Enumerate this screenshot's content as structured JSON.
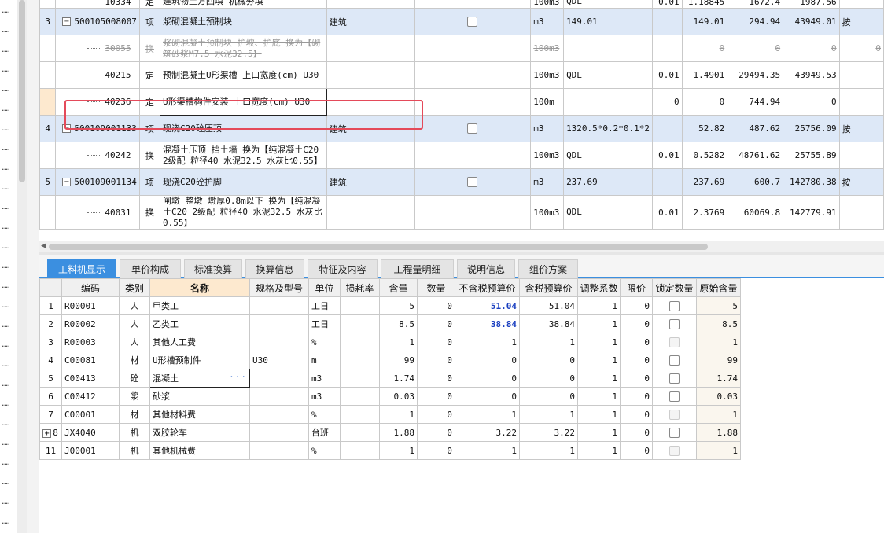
{
  "top_rows": [
    {
      "kind": "child",
      "seq": "",
      "code": "10334",
      "cat": "定",
      "name": "建筑物土方回填 机械夯填",
      "major": "",
      "unit": "100m3",
      "qty_expr": "QDL",
      "content": "0.01",
      "qty": "1.18845",
      "price": "1672.4",
      "total": "1987.56",
      "extra": ""
    },
    {
      "kind": "main",
      "seq": "3",
      "code": "500105008007",
      "cat": "项",
      "name": "浆砌混凝土预制块",
      "major": "建筑",
      "unit": "m3",
      "qty_expr": "149.01",
      "content": "",
      "qty": "149.01",
      "price": "294.94",
      "total": "43949.01",
      "extra": "按"
    },
    {
      "kind": "strike",
      "seq": "",
      "code": "30055",
      "cat": "换",
      "name": "浆砌混凝土预制块 护坡、护底  换为【砌筑砂浆M7.5 水泥32.5】",
      "major": "",
      "unit": "100m3",
      "qty_expr": "",
      "content": "",
      "qty": "0",
      "price": "0",
      "total": "0",
      "extra": "0"
    },
    {
      "kind": "child",
      "seq": "",
      "code": "40215",
      "cat": "定",
      "name": "预制混凝土U形渠槽 上口宽度(cm) U30",
      "major": "",
      "unit": "100m3",
      "qty_expr": "QDL",
      "content": "0.01",
      "qty": "1.4901",
      "price": "29494.35",
      "total": "43949.53",
      "extra": ""
    },
    {
      "kind": "edit",
      "seq": "",
      "code": "40236",
      "cat": "定",
      "name": "U形渠槽构件安装 上口宽度(cm) U30",
      "major": "",
      "unit": "100m",
      "qty_expr": "",
      "content": "0",
      "qty": "0",
      "price": "744.94",
      "total": "0",
      "extra": ""
    },
    {
      "kind": "main",
      "seq": "4",
      "code": "500109001133",
      "cat": "项",
      "name": "现浇C20砼压顶",
      "major": "建筑",
      "unit": "m3",
      "qty_expr": "1320.5*0.2*0.1*2",
      "content": "",
      "qty": "52.82",
      "price": "487.62",
      "total": "25756.09",
      "extra": "按"
    },
    {
      "kind": "child",
      "seq": "",
      "code": "40242",
      "cat": "换",
      "name": "混凝土压顶 挡土墙  换为【纯混凝土C20 2级配 粒径40 水泥32.5 水灰比0.55】",
      "major": "",
      "unit": "100m3",
      "qty_expr": "QDL",
      "content": "0.01",
      "qty": "0.5282",
      "price": "48761.62",
      "total": "25755.89",
      "extra": ""
    },
    {
      "kind": "main",
      "seq": "5",
      "code": "500109001134",
      "cat": "项",
      "name": "现浇C20砼护脚",
      "major": "建筑",
      "unit": "m3",
      "qty_expr": "237.69",
      "content": "",
      "qty": "237.69",
      "price": "600.7",
      "total": "142780.38",
      "extra": "按"
    },
    {
      "kind": "child",
      "seq": "",
      "code": "40031",
      "cat": "换",
      "name": "闸墩 整墩 墩厚0.8m以下  换为【纯混凝土C20 2级配 粒径40 水泥32.5 水灰比0.55】",
      "major": "",
      "unit": "100m3",
      "qty_expr": "QDL",
      "content": "0.01",
      "qty": "2.3769",
      "price": "60069.8",
      "total": "142779.91",
      "extra": ""
    }
  ],
  "tabs": [
    "工料机显示",
    "单价构成",
    "标准换算",
    "换算信息",
    "特征及内容",
    "工程量明细",
    "说明信息",
    "组价方案"
  ],
  "columns": [
    "",
    "编码",
    "类别",
    "名称",
    "规格及型号",
    "单位",
    "损耗率",
    "含量",
    "数量",
    "不含税预算价",
    "含税预算价",
    "调整系数",
    "限价",
    "锁定数量",
    "原始含量"
  ],
  "rows": [
    {
      "n": "1",
      "code": "R00001",
      "cat": "人",
      "name": "甲类工",
      "spec": "",
      "unit": "工日",
      "loss": "",
      "amt": "5",
      "qty": "0",
      "p1": "51.04",
      "p2": "51.04",
      "adj": "1",
      "limit": "0",
      "orig": "5",
      "blue": true,
      "dis": false
    },
    {
      "n": "2",
      "code": "R00002",
      "cat": "人",
      "name": "乙类工",
      "spec": "",
      "unit": "工日",
      "loss": "",
      "amt": "8.5",
      "qty": "0",
      "p1": "38.84",
      "p2": "38.84",
      "adj": "1",
      "limit": "0",
      "orig": "8.5",
      "blue": true,
      "dis": false
    },
    {
      "n": "3",
      "code": "R00003",
      "cat": "人",
      "name": "其他人工费",
      "spec": "",
      "unit": "%",
      "loss": "",
      "amt": "1",
      "qty": "0",
      "p1": "1",
      "p2": "1",
      "adj": "1",
      "limit": "0",
      "orig": "1",
      "blue": false,
      "dis": true
    },
    {
      "n": "4",
      "code": "C00081",
      "cat": "材",
      "name": "U形槽预制件",
      "spec": "U30",
      "unit": "m",
      "loss": "",
      "amt": "99",
      "qty": "0",
      "p1": "0",
      "p2": "0",
      "adj": "1",
      "limit": "0",
      "orig": "99",
      "blue": false,
      "dis": false
    },
    {
      "n": "5",
      "code": "C00413",
      "cat": "砼",
      "name": "混凝土",
      "spec": "",
      "unit": "m3",
      "loss": "",
      "amt": "1.74",
      "qty": "0",
      "p1": "0",
      "p2": "0",
      "adj": "1",
      "limit": "0",
      "orig": "1.74",
      "blue": false,
      "dis": false,
      "sel": true
    },
    {
      "n": "6",
      "code": "C00412",
      "cat": "浆",
      "name": "砂浆",
      "spec": "",
      "unit": "m3",
      "loss": "",
      "amt": "0.03",
      "qty": "0",
      "p1": "0",
      "p2": "0",
      "adj": "1",
      "limit": "0",
      "orig": "0.03",
      "blue": false,
      "dis": false
    },
    {
      "n": "7",
      "code": "C00001",
      "cat": "材",
      "name": "其他材料费",
      "spec": "",
      "unit": "%",
      "loss": "",
      "amt": "1",
      "qty": "0",
      "p1": "1",
      "p2": "1",
      "adj": "1",
      "limit": "0",
      "orig": "1",
      "blue": false,
      "dis": true
    },
    {
      "n": "8",
      "code": "JX4040",
      "cat": "机",
      "name": "双胶轮车",
      "spec": "",
      "unit": "台班",
      "loss": "",
      "amt": "1.88",
      "qty": "0",
      "p1": "3.22",
      "p2": "3.22",
      "adj": "1",
      "limit": "0",
      "orig": "1.88",
      "blue": false,
      "dis": false,
      "expand": true
    },
    {
      "n": "11",
      "code": "J00001",
      "cat": "机",
      "name": "其他机械费",
      "spec": "",
      "unit": "%",
      "loss": "",
      "amt": "1",
      "qty": "0",
      "p1": "1",
      "p2": "1",
      "adj": "1",
      "limit": "0",
      "orig": "1",
      "blue": false,
      "dis": true
    }
  ],
  "ellipsis": "···",
  "expand_sign": "+",
  "collapse_sign": "−",
  "left_dots": "....",
  "scroll_arrow": "◀"
}
